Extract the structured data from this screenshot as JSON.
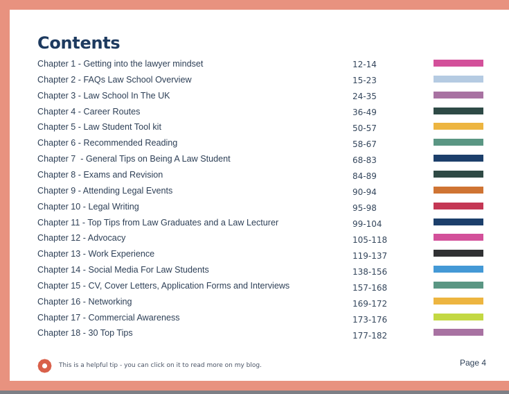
{
  "title": "Contents",
  "chapters": [
    {
      "label": "Chapter 1 - Getting into the lawyer mindset",
      "pages": "12-14",
      "color": "#d3509a"
    },
    {
      "label": "Chapter 2 - FAQs Law School Overview",
      "pages": "15-23",
      "color": "#b5cbe2"
    },
    {
      "label": "Chapter 3 - Law School In The UK",
      "pages": "24-35",
      "color": "#a872a2"
    },
    {
      "label": "Chapter 4 - Career Routes",
      "pages": "36-49",
      "color": "#2e4a46"
    },
    {
      "label": "Chapter 5 - Law Student Tool kit",
      "pages": "50-57",
      "color": "#edb540"
    },
    {
      "label": "Chapter 6 - Recommended Reading",
      "pages": "58-67",
      "color": "#5a9683"
    },
    {
      "label": "Chapter 7  - General Tips on Being A Law Student",
      "pages": "68-83",
      "color": "#1c3f6b"
    },
    {
      "label": "Chapter 8 - Exams and Revision",
      "pages": "84-89",
      "color": "#2f4a45"
    },
    {
      "label": "Chapter 9 - Attending Legal Events",
      "pages": "90-94",
      "color": "#cf7433"
    },
    {
      "label": "Chapter 10 - Legal Writing",
      "pages": "95-98",
      "color": "#c43754"
    },
    {
      "label": "Chapter 11 - Top Tips from Law Graduates and a Law Lecturer",
      "pages": "99-104",
      "color": "#1c3f6b"
    },
    {
      "label": "Chapter 12 - Advocacy",
      "pages": "105-118",
      "color": "#d3509a"
    },
    {
      "label": "Chapter 13 - Work Experience",
      "pages": "119-137",
      "color": "#303133"
    },
    {
      "label": "Chapter 14 - Social Media For Law Students",
      "pages": "138-156",
      "color": "#4499d6"
    },
    {
      "label": "Chapter 15 - CV, Cover Letters, Application Forms and Interviews",
      "pages": "157-168",
      "color": "#5a9683"
    },
    {
      "label": "Chapter 16 - Networking",
      "pages": "169-172",
      "color": "#edb540"
    },
    {
      "label": "Chapter 17 - Commercial Awareness",
      "pages": "173-176",
      "color": "#c3d843"
    },
    {
      "label": "Chapter 18 - 30 Top Tips",
      "pages": "177-182",
      "color": "#a872a2"
    }
  ],
  "tip": {
    "icon": "tip-badge-icon",
    "icon_color": "#d9604a",
    "text": "This is a helpful tip - you can click on it to read more on my blog."
  },
  "page_label": "Page 4",
  "colors": {
    "frame": "#e8927f",
    "title": "#1d3a5f",
    "text": "#2e4057"
  }
}
